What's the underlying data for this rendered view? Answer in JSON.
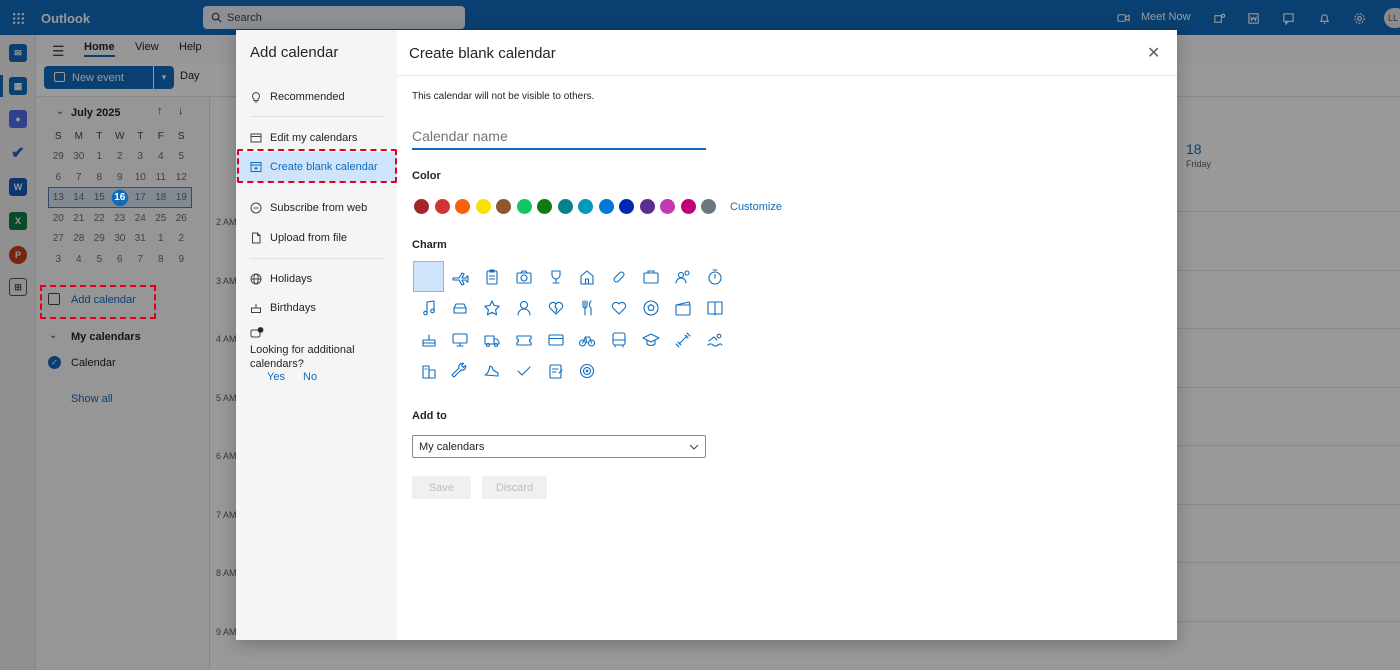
{
  "app": {
    "title": "Outlook",
    "search_placeholder": "Search",
    "meet_now": "Meet Now",
    "avatar_initials": "LL"
  },
  "ribbon": {
    "tabs": [
      "Home",
      "View",
      "Help"
    ],
    "new_event": "New event",
    "day": "Day"
  },
  "mini_calendar": {
    "month": "July 2025",
    "weekdays": [
      "S",
      "M",
      "T",
      "W",
      "T",
      "F",
      "S"
    ],
    "weeks": [
      [
        "29",
        "30",
        "1",
        "2",
        "3",
        "4",
        "5"
      ],
      [
        "6",
        "7",
        "8",
        "9",
        "10",
        "11",
        "12"
      ],
      [
        "13",
        "14",
        "15",
        "16",
        "17",
        "18",
        "19"
      ],
      [
        "20",
        "21",
        "22",
        "23",
        "24",
        "25",
        "26"
      ],
      [
        "27",
        "28",
        "29",
        "30",
        "31",
        "1",
        "2"
      ],
      [
        "3",
        "4",
        "5",
        "6",
        "7",
        "8",
        "9"
      ]
    ],
    "today": "16"
  },
  "sidebar": {
    "add_calendar": "Add calendar",
    "my_calendars": "My calendars",
    "calendar": "Calendar",
    "show_all": "Show all"
  },
  "grid": {
    "day_number": "18",
    "day_name": "Friday",
    "times": [
      "2 AM",
      "3 AM",
      "4 AM",
      "5 AM",
      "6 AM",
      "7 AM",
      "8 AM",
      "9 AM"
    ]
  },
  "dialog": {
    "nav_title": "Add calendar",
    "nav": {
      "recommended": "Recommended",
      "edit_my_calendars": "Edit my calendars",
      "create_blank_calendar": "Create blank calendar",
      "subscribe_from_web": "Subscribe from web",
      "upload_from_file": "Upload from file",
      "holidays": "Holidays",
      "birthdays": "Birthdays"
    },
    "looking": "Looking for additional calendars?",
    "yes": "Yes",
    "no": "No",
    "title": "Create blank calendar",
    "visibility_note": "This calendar will not be visible to others.",
    "name_placeholder": "Calendar name",
    "color_label": "Color",
    "colors": [
      "#a4262c",
      "#d13438",
      "#f7630c",
      "#fce100",
      "#8e562e",
      "#13c464",
      "#107c10",
      "#038387",
      "#0099bc",
      "#0078d4",
      "#0027b4",
      "#5c2e91",
      "#c239b3",
      "#bf0077",
      "#69797e"
    ],
    "customize": "Customize",
    "charm_label": "Charm",
    "charms": [
      "none",
      "airplane",
      "clipboard",
      "camera",
      "trophy",
      "home",
      "pill",
      "briefcase",
      "people",
      "stopwatch",
      "music",
      "car",
      "star",
      "person",
      "heart-broken",
      "food",
      "heart",
      "soccer-ball",
      "clapper",
      "book",
      "cake",
      "monitor",
      "truck",
      "ticket",
      "credit-card",
      "bicycle",
      "bus",
      "graduation-cap",
      "dumbbell",
      "swim",
      "building",
      "wrench",
      "running-shoe",
      "checkmark",
      "notepad",
      "target"
    ],
    "add_to_label": "Add to",
    "add_to_value": "My calendars",
    "save": "Save",
    "discard": "Discard"
  },
  "accent": "#0f6cbd"
}
